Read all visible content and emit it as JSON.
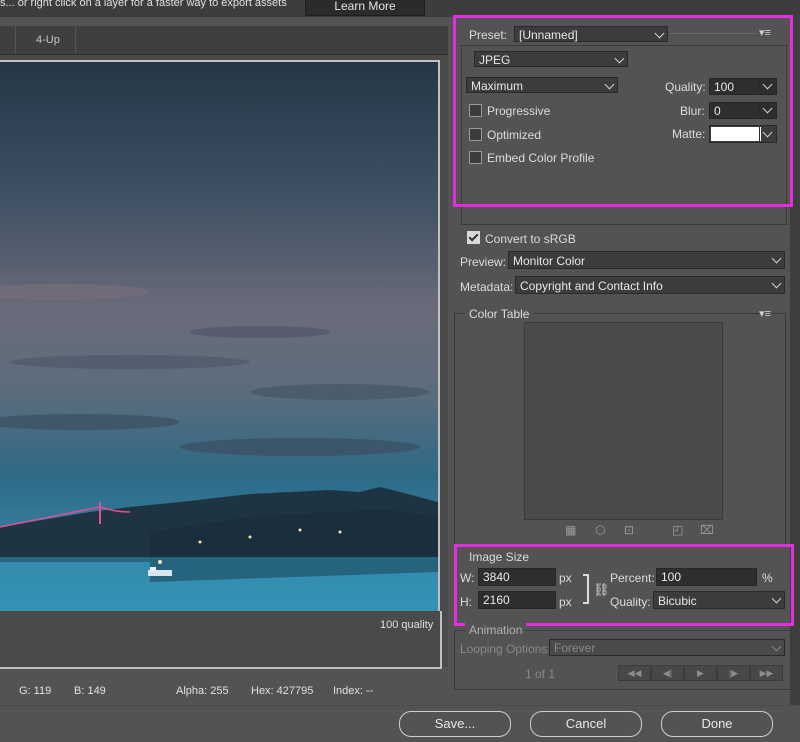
{
  "topbar": {
    "hint_text": "s...  or right click on a layer for a faster way to export assets",
    "learn_more": "Learn More"
  },
  "tabs": [
    {
      "label": "4-Up"
    }
  ],
  "preview": {
    "quality_caption": "100 quality"
  },
  "status": {
    "g": "G: 119",
    "b": "B: 149",
    "alpha": "Alpha: 255",
    "hex": "Hex: 427795",
    "index": "Index: --"
  },
  "settings": {
    "preset_label": "Preset:",
    "preset_value": "[Unnamed]",
    "format_value": "JPEG",
    "quality_level": "Maximum",
    "quality_label": "Quality:",
    "quality_value": "100",
    "progressive_label": "Progressive",
    "blur_label": "Blur:",
    "blur_value": "0",
    "optimized_label": "Optimized",
    "matte_label": "Matte:",
    "embed_label": "Embed Color Profile",
    "convert_label": "Convert to sRGB",
    "preview_label": "Preview:",
    "preview_value": "Monitor Color",
    "metadata_label": "Metadata:",
    "metadata_value": "Copyright and Contact Info",
    "matte_color": "#ffffff"
  },
  "color_table": {
    "title": "Color Table"
  },
  "image_size": {
    "title": "Image Size",
    "w_label": "W:",
    "w_value": "3840",
    "h_label": "H:",
    "h_value": "2160",
    "unit": "px",
    "percent_label": "Percent:",
    "percent_value": "100",
    "percent_unit": "%",
    "quality_label": "Quality:",
    "quality_value": "Bicubic"
  },
  "animation": {
    "title": "Animation",
    "looping_label": "Looping Options:",
    "looping_value": "Forever",
    "frame_counter": "1 of 1"
  },
  "buttons": {
    "save": "Save...",
    "cancel": "Cancel",
    "done": "Done"
  },
  "accent_highlight": "#e52de0"
}
